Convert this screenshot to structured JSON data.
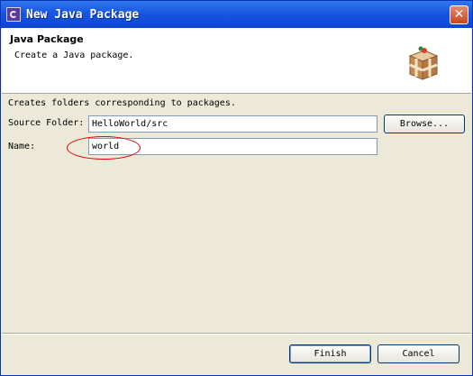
{
  "window": {
    "title": "New Java Package",
    "close_glyph": "✕"
  },
  "header": {
    "title": "Java Package",
    "description": "Create a Java package.",
    "icon": "package-icon"
  },
  "form": {
    "info": "Creates folders corresponding to packages.",
    "source_folder_label": "Source Folder:",
    "source_folder_value": "HelloWorld/src",
    "browse_label": "Browse...",
    "name_label": "Name:",
    "name_value": "world"
  },
  "footer": {
    "finish_label": "Finish",
    "cancel_label": "Cancel"
  },
  "colors": {
    "titlebar": "#1856e0",
    "dialog_bg": "#ece9d8",
    "annotation_circle": "#e00000"
  }
}
